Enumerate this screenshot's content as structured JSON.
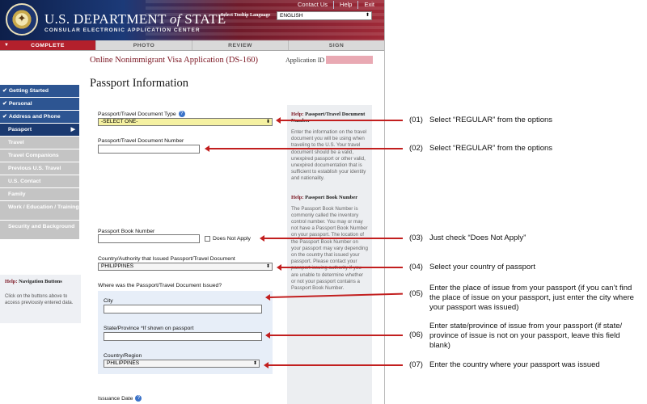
{
  "header": {
    "title_part1": "U.S. DEPARTMENT ",
    "title_of": "of",
    "title_part2": " STATE",
    "subtitle": "CONSULAR ELECTRONIC APPLICATION CENTER",
    "links": [
      "Contact Us",
      "Help",
      "Exit"
    ],
    "tooltip_language_label": "Select Tooltip Language",
    "language_value": "ENGLISH"
  },
  "tabs": [
    "COMPLETE",
    "PHOTO",
    "REVIEW",
    "SIGN"
  ],
  "appbar": {
    "title": "Online Nonimmigrant Visa Application (DS-160)",
    "id_label": "Application ID"
  },
  "sidebar": {
    "items": [
      {
        "label": "Getting Started"
      },
      {
        "label": "Personal"
      },
      {
        "label": "Address and Phone"
      },
      {
        "label": "Passport"
      },
      {
        "label": "Travel"
      },
      {
        "label": "Travel Companions"
      },
      {
        "label": "Previous U.S. Travel"
      },
      {
        "label": "U.S. Contact"
      },
      {
        "label": "Family"
      },
      {
        "label": "Work / Education / Training"
      },
      {
        "label": "Security and Background"
      }
    ],
    "help_title_prefix": "Help:",
    "help_title": "Navigation Buttons",
    "help_text": "Click on the buttons above to access previously entered data."
  },
  "form": {
    "page_title": "Passport Information",
    "doc_type_label": "Passport/Travel Document Type",
    "doc_type_value": "-SELECT ONE-",
    "doc_number_label": "Passport/Travel Document Number",
    "book_number_label": "Passport Book Number",
    "does_not_apply_label": "Does Not Apply",
    "country_label": "Country/Authority that Issued Passport/Travel Document",
    "country_value": "PHILIPPINES",
    "issued_question": "Where was the Passport/Travel Document Issued?",
    "city_label": "City",
    "state_label": "State/Province *If shown on passport",
    "region_label": "Country/Region",
    "region_value": "PHILIPPINES",
    "issuance_label": "Issuance Date",
    "help_icon": "?"
  },
  "help_panel": {
    "title1_prefix": "Help:",
    "title1": "Passport/Travel Document Number",
    "text1": "Enter the information on the travel document you will be using when traveling to the U.S. Your travel document should be a valid, unexpired passport or other valid, unexpired documentation that is sufficient to establish your identity and nationality.",
    "title2_prefix": "Help:",
    "title2": "Passport Book Number",
    "text2": "The Passport Book Number is commonly called the inventory control number. You may or may not have a Passport Book Number on your passport. The location of the Passport Book Number on your passport may vary depending on the country that issued your passport. Please contact your passport issuing authority if you are unable to determine whether or not your passport contains a Passport Book Number."
  },
  "annotations": [
    {
      "num": "(01)",
      "text": "Select “REGULAR” from the options"
    },
    {
      "num": "(02)",
      "text": "Select “REGULAR” from the options"
    },
    {
      "num": "(03)",
      "text": "Just check “Does Not Apply”"
    },
    {
      "num": "(04)",
      "text": "Select your country of passport"
    },
    {
      "num": "(05)",
      "text": "Enter the place of issue from your passport (if you can’t find the place of issue on your passport, just enter the city where your passport was issued)"
    },
    {
      "num": "(06)",
      "text": "Enter state/province of issue from your passport (if state/ province of issue is not on your passport, leave this field blank)"
    },
    {
      "num": "(07)",
      "text": "Enter the country where your passport was issued"
    }
  ],
  "colors": {
    "accent_red": "#b3202c",
    "nav_blue": "#2d5592",
    "annotation_red": "#c21f1f"
  }
}
